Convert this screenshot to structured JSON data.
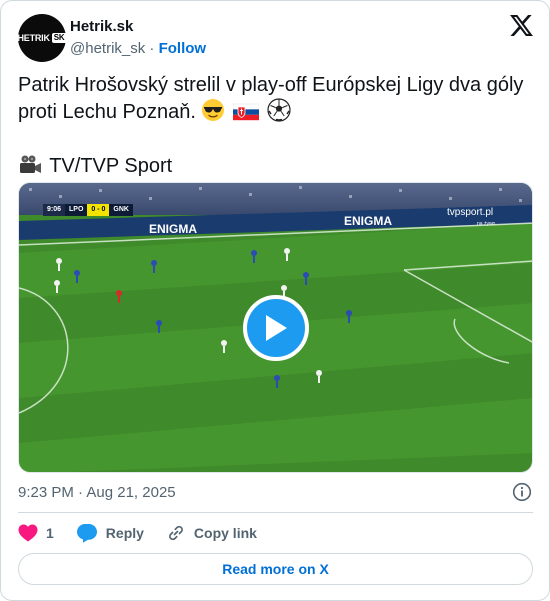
{
  "author": {
    "name": "Hetrik.sk",
    "handle": "@hetrik_sk",
    "separator": "·",
    "follow_label": "Follow",
    "avatar_logo_text": "HETRIK",
    "avatar_logo_badge": "SK"
  },
  "post": {
    "text_line1": "Patrik Hrošovský strelil v play-off Európskej Ligy dva góly proti Lechu Poznaň.",
    "text_line2": "TV/TVP Sport",
    "emojis": [
      "smiling-face-with-sunglasses",
      "flag-slovakia",
      "soccer-ball",
      "movie-camera"
    ]
  },
  "media": {
    "type": "video",
    "scoreboard": {
      "time": "9:06",
      "home": "LPO",
      "score": "0 - 0",
      "away": "GNK"
    },
    "ad_board_text": "ENIGMA",
    "ad_board_text_2": "tvpsport.pl",
    "ad_board_text_3": "na żywo",
    "pitch_color": "#3f8a2a",
    "play_button_color": "#1d9bf0"
  },
  "timestamp": {
    "time": "9:23 PM",
    "separator": "·",
    "date": "Aug 21, 2025"
  },
  "actions": {
    "like_count": "1",
    "reply_label": "Reply",
    "copy_link_label": "Copy link"
  },
  "read_more_label": "Read more on X",
  "colors": {
    "link_blue": "#006fd6",
    "muted": "#536471",
    "like_red": "#f91880",
    "border": "#cfd9de"
  }
}
